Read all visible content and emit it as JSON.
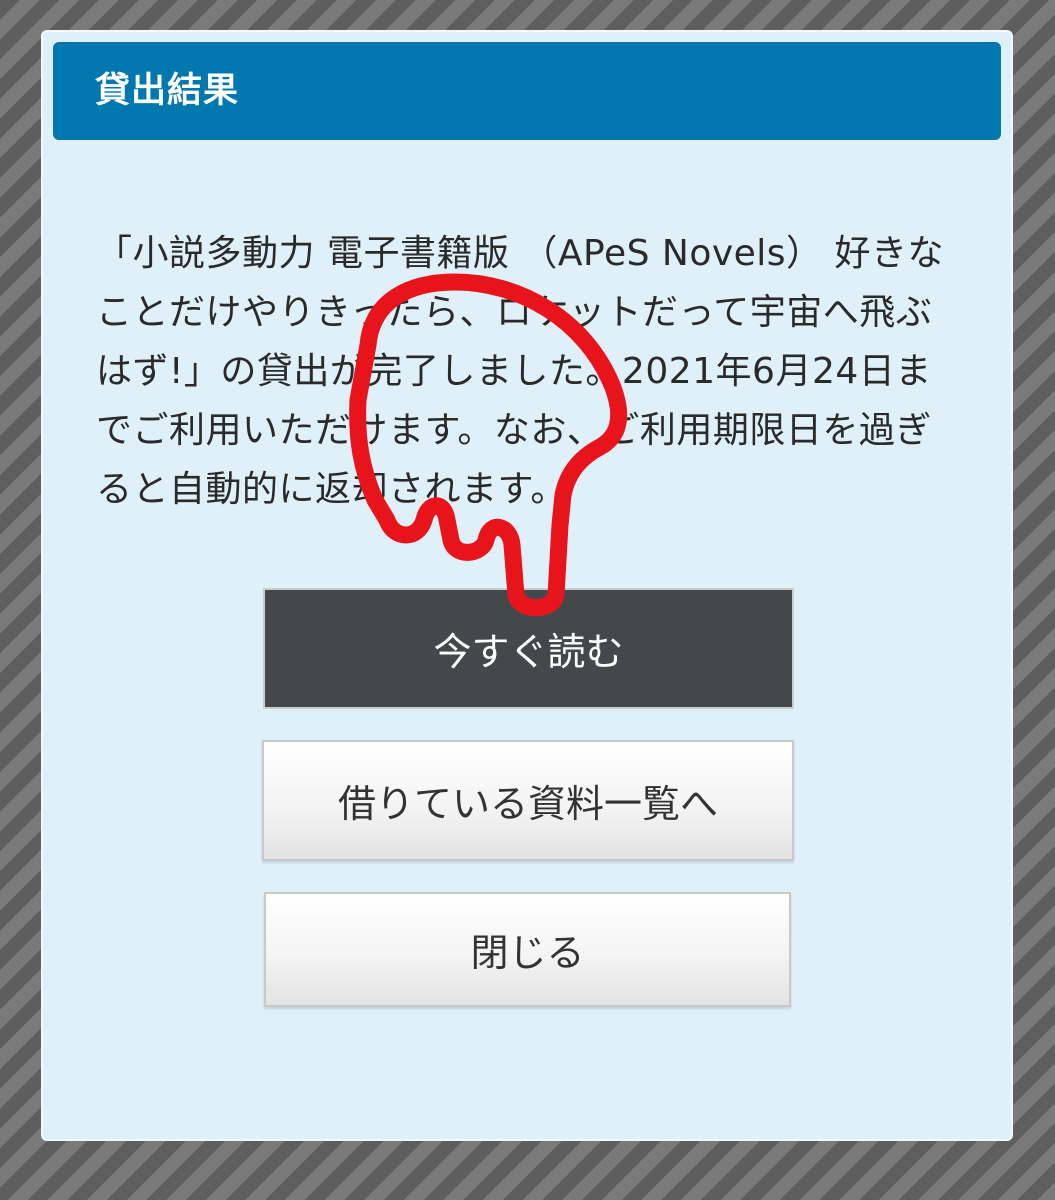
{
  "dialog": {
    "title": "貸出結果",
    "message": "「小説多動力 電子書籍版 （APeS Novels） 好きなことだけやりきったら、ロケットだって宇宙へ飛ぶはず!」の貸出が完了しました。2021年6月24日までご利用いただけます。なお、ご利用期限日を過ぎると自動的に返却されます。",
    "buttons": {
      "read_now": "今すぐ読む",
      "borrowed_list": "借りている資料一覧へ",
      "close": "閉じる"
    }
  },
  "colors": {
    "header": "#0077ae",
    "panel": "#dff0f9",
    "primary_button": "#43484b",
    "annotation": "#e8141c"
  },
  "annotation": {
    "icon": "pointing-hand-icon"
  }
}
